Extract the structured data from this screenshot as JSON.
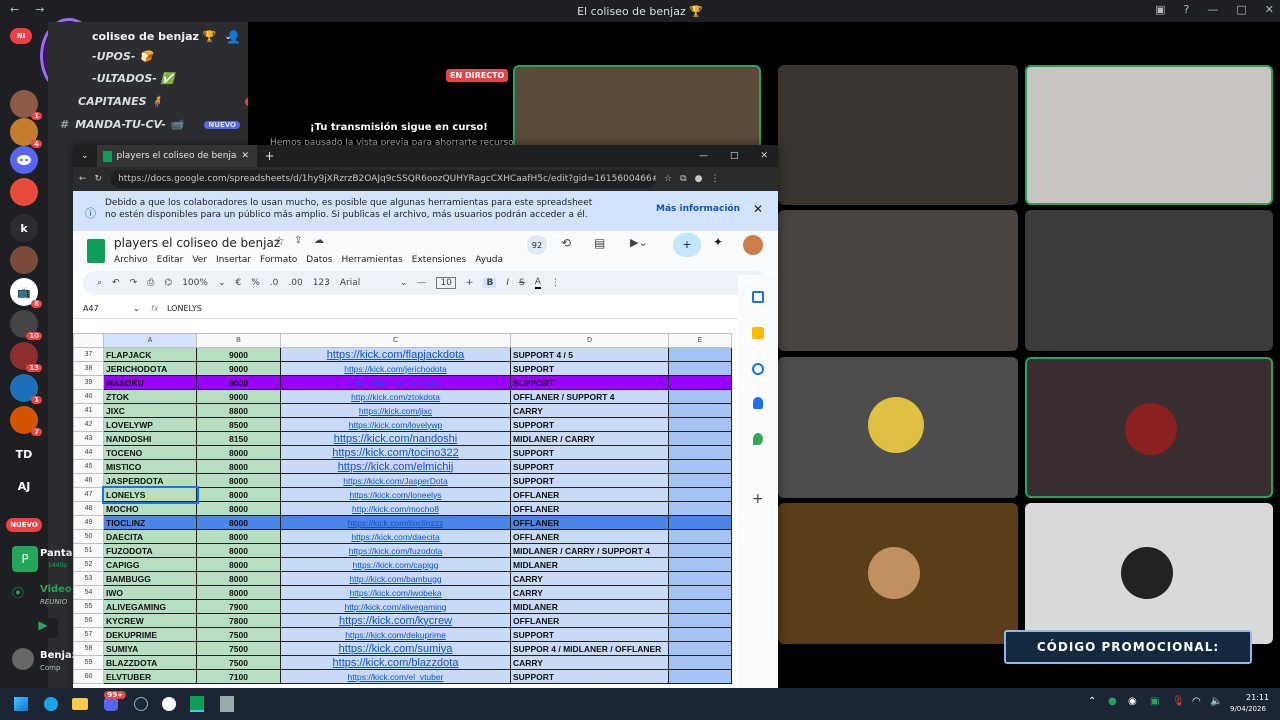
{
  "window": {
    "title": "El coliseo de benjaz 🏆"
  },
  "server": {
    "name": "coliseo de benjaz 🏆"
  },
  "channels": [
    {
      "label": "-UPOS- 🍞"
    },
    {
      "label": "-ULTADOS- ✅"
    },
    {
      "label": "CAPITANES 🧍"
    },
    {
      "label": "MANDA-TU-CV- 📹"
    }
  ],
  "channel_badges": {
    "capitanes": "2",
    "manda": "NUEVO"
  },
  "rail_labels": {
    "k": "k",
    "td": "TD",
    "aj": "AJ",
    "nuevo": "NUEVO",
    "ni": "NI"
  },
  "rail_badges": [
    "1",
    "4",
    "8",
    "10",
    "13",
    "1",
    "7"
  ],
  "voice": {
    "screen": "Pantal",
    "quality": "1440p",
    "video": "Video",
    "reunion": "REUNIO",
    "user": "Benjaz",
    "user_sub": "Comp"
  },
  "live": {
    "badge": "EN DIRECTO",
    "notice": "¡Tu transmisión sigue en curso!",
    "notice_sub": "Hemos pausado la vista previa para ahorrarte recursos"
  },
  "promo": "CÓDIGO PROMOCIONAL:",
  "browser": {
    "tab_title": "players el coliseo de benjaz - Hoja",
    "url": "https://docs.google.com/spreadsheets/d/1hy9jXRzrzB2OAJq9cSSQR6oozQUHYRagcCXHCaafH5c/edit?gid=1615600466#gi...",
    "banner_text": "Debido a que los colaboradores lo usan mucho, es posible que algunas herramientas para este spreadsheet no estén disponibles para un público más amplio. Si publicas el archivo, más usuarios podrán acceder a él.",
    "banner_link": "Más información"
  },
  "sheet": {
    "title": "players el coliseo de benjaz",
    "menu": [
      "Archivo",
      "Editar",
      "Ver",
      "Insertar",
      "Formato",
      "Datos",
      "Herramientas",
      "Extensiones",
      "Ayuda"
    ],
    "zoom": "100%",
    "currency": "€",
    "percent": "%",
    "dec_less": ".0",
    "dec_more": ".00",
    "number_fmt": "123",
    "font": "Arial",
    "font_size": "10",
    "bold": "B",
    "italic": "I",
    "strike": "S",
    "textcolor": "A",
    "cell_ref": "A47",
    "fx": "fx",
    "formula": "LONELYS",
    "activity_count": "92",
    "columns": [
      "A",
      "B",
      "C",
      "D",
      "E"
    ],
    "rows": [
      {
        "n": "37",
        "a": "FLAPJACK",
        "b": "9000",
        "c": "https://kick.com/flapjackdota",
        "d": "SUPPORT 4 / 5",
        "big": true
      },
      {
        "n": "38",
        "a": "JERICHODOTA",
        "b": "9000",
        "c": "https://kick.com/jerichodota",
        "d": "SUPPORT"
      },
      {
        "n": "39",
        "a": "MASOKU",
        "b": "9000",
        "c": "https://kick.com/masoku",
        "d": "SUPPORT",
        "hl": "purple"
      },
      {
        "n": "40",
        "a": "ZTOK",
        "b": "9000",
        "c": "http://kick.com/ztokdota",
        "d": "OFFLANER / SUPPORT 4"
      },
      {
        "n": "41",
        "a": "JIXC",
        "b": "8800",
        "c": "https://kick.com/jixc",
        "d": "CARRY"
      },
      {
        "n": "42",
        "a": "LOVELYWP",
        "b": "8500",
        "c": "https://kick.com/lovelywp",
        "d": "SUPPORT"
      },
      {
        "n": "43",
        "a": "NANDOSHI",
        "b": "8150",
        "c": "https://kick.com/nandoshi",
        "d": "MIDLANER / CARRY",
        "big": true
      },
      {
        "n": "44",
        "a": "TOCENO",
        "b": "8000",
        "c": "https://kick.com/tocino322",
        "d": "SUPPORT",
        "big": true
      },
      {
        "n": "45",
        "a": "MISTICO",
        "b": "8000",
        "c": "https://kick.com/elmichij",
        "d": "SUPPORT",
        "big": true
      },
      {
        "n": "46",
        "a": "JASPERDOTA",
        "b": "8000",
        "c": "https://kick.com/JasperDota",
        "d": "SUPPORT"
      },
      {
        "n": "47",
        "a": "LONELYS",
        "b": "8000",
        "c": "https://kick.com/loneelys",
        "d": "OFFLANER",
        "sel": true
      },
      {
        "n": "48",
        "a": "MOCHO",
        "b": "8000",
        "c": "http://kick.com/mocho8",
        "d": "OFFLANER"
      },
      {
        "n": "49",
        "a": "TIOCLINZ",
        "b": "8000",
        "c": "https://kick.com/tioclinzzz",
        "d": "OFFLANER",
        "hl": "blue"
      },
      {
        "n": "50",
        "a": "DAECITA",
        "b": "8000",
        "c": "https://kick.com/daecita",
        "d": "OFFLANER"
      },
      {
        "n": "51",
        "a": "FUZODOTA",
        "b": "8000",
        "c": "https://kick.com/fuzodota",
        "d": "MIDLANER / CARRY / SUPPORT 4"
      },
      {
        "n": "52",
        "a": "CAPIGG",
        "b": "8000",
        "c": "https://kick.com/capigg",
        "d": "MIDLANER"
      },
      {
        "n": "53",
        "a": "BAMBUGG",
        "b": "8000",
        "c": "http://kick.com/bambugg",
        "d": "CARRY"
      },
      {
        "n": "54",
        "a": "IWO",
        "b": "8000",
        "c": "https://kick.com/iwobeka",
        "d": "CARRY"
      },
      {
        "n": "55",
        "a": "ALIVEGAMING",
        "b": "7900",
        "c": "http://kick.com/alivegaming",
        "d": "MIDLANER"
      },
      {
        "n": "56",
        "a": "KYCREW",
        "b": "7800",
        "c": "https://kick.com/kycrew",
        "d": "OFFLANER",
        "big": true
      },
      {
        "n": "57",
        "a": "DEKUPRIME",
        "b": "7500",
        "c": "https://kick.com/dekuprime",
        "d": "SUPPORT"
      },
      {
        "n": "58",
        "a": "SUMIYA",
        "b": "7500",
        "c": "https://kick.com/sumiya",
        "d": "SUPPOR 4 / MIDLANER / OFFLANER",
        "big": true
      },
      {
        "n": "59",
        "a": "BLAZZDOTA",
        "b": "7500",
        "c": "https://kick.com/blazzdota",
        "d": "CARRY",
        "big": true
      },
      {
        "n": "60",
        "a": "ELVTUBER",
        "b": "7100",
        "c": "https://kick.com/el_vtuber",
        "d": "SUPPORT"
      }
    ]
  },
  "taskbar": {
    "time": "21:11",
    "date": "9/04/2026",
    "steam_badge": "99+"
  },
  "colors": {
    "green_row": "#b6dfc1",
    "purple": "#9900ff",
    "blue": "#4a86e8",
    "live_red": "#ed4245"
  }
}
